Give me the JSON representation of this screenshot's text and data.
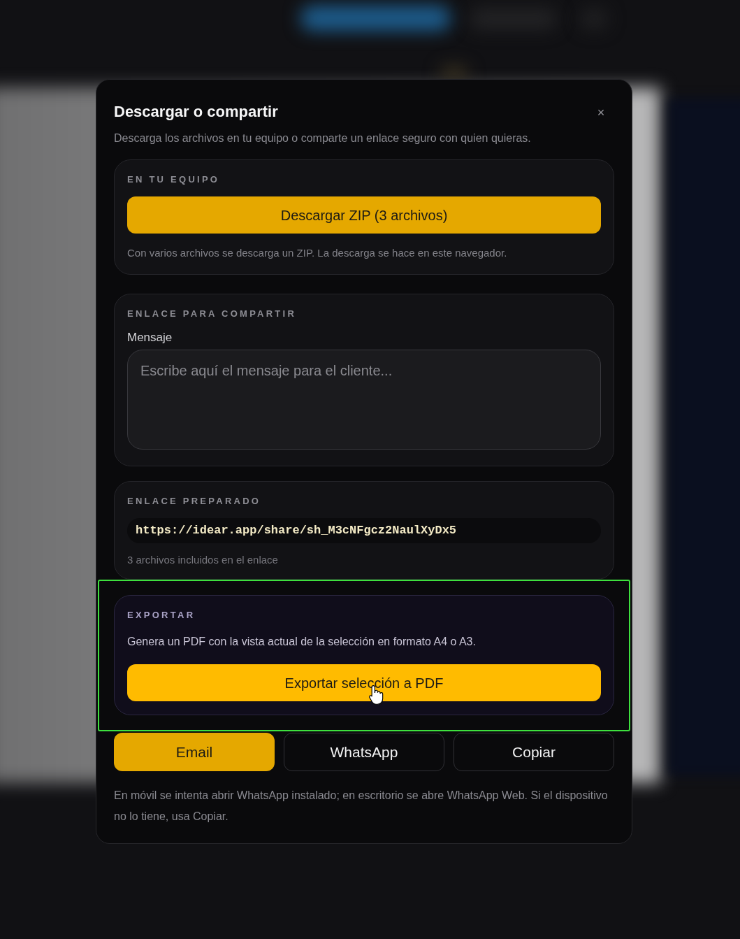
{
  "dialog": {
    "title": "Descargar o compartir",
    "subtitle": "Descarga los archivos en tu equipo o comparte un enlace seguro con quien quieras.",
    "close_label": "×"
  },
  "sections": [
    {
      "kind": "download",
      "heading": "EN TU EQUIPO",
      "highlighted": false,
      "button": {
        "label": "Descargar ZIP (3 archivos)",
        "hovered": false
      },
      "note": "Con varios archivos se descarga un ZIP. La descarga se hace en este navegador."
    },
    {
      "kind": "message",
      "heading": "ENLACE PARA COMPARTIR",
      "highlighted": false,
      "field_label": "Mensaje",
      "placeholder": "Escribe aquí el mensaje para el cliente..."
    },
    {
      "kind": "link",
      "heading": "ENLACE PREPARADO",
      "highlighted": false,
      "url": "https://idear.app/share/sh_M3cNFgcz2NaulXyDx5",
      "note": "3 archivos incluidos en el enlace"
    },
    {
      "kind": "export",
      "heading": "EXPORTAR",
      "highlighted": true,
      "description": "Genera un PDF con la vista actual de la selección en formato A4 o A3.",
      "button": {
        "label": "Exportar selección a PDF",
        "hovered": true
      }
    }
  ],
  "share_buttons": [
    {
      "label": "Email",
      "selected": true
    },
    {
      "label": "WhatsApp",
      "selected": false
    },
    {
      "label": "Copiar",
      "selected": false
    }
  ],
  "footer_note": "En móvil se intenta abrir WhatsApp instalado; en escritorio se abre WhatsApp Web. Si el dispositivo no lo tiene, usa Copiar."
}
